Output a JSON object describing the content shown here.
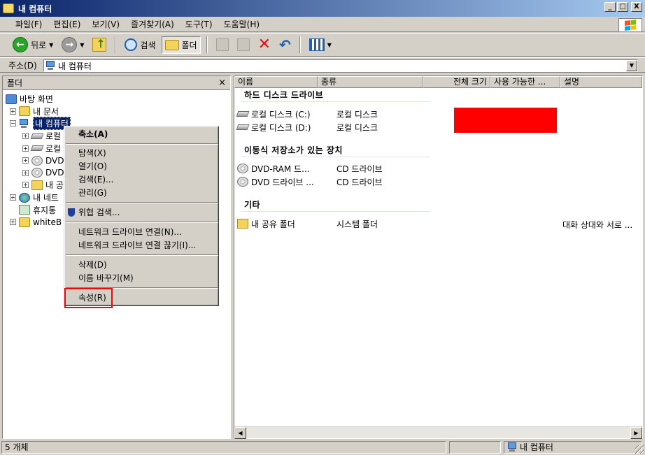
{
  "window": {
    "title": "내 컴퓨터",
    "buttons": {
      "minimize": "_",
      "maximize": "□",
      "close": "X"
    }
  },
  "menubar": {
    "items": [
      "파일(F)",
      "편집(E)",
      "보기(V)",
      "즐겨찾기(A)",
      "도구(T)",
      "도움말(H)"
    ]
  },
  "toolbar": {
    "back_label": "뒤로",
    "search_label": "검색",
    "folders_label": "폴더",
    "icons": {
      "back": "back-arrow-icon",
      "forward": "forward-arrow-icon",
      "up": "folder-up-icon",
      "search": "magnifier-icon",
      "folders": "folders-icon",
      "move_to": "move-to-icon",
      "copy_to": "copy-to-icon",
      "delete": "delete-x-icon",
      "undo": "undo-icon",
      "views": "views-icon"
    }
  },
  "address": {
    "label": "주소(D)",
    "value": "내 컴퓨터"
  },
  "folder_pane": {
    "title": "폴더",
    "close": "×",
    "tree": [
      {
        "label": "바탕 화면",
        "icon": "desktop-icon"
      },
      {
        "label": "내 문서",
        "icon": "folder-icon"
      },
      {
        "label": "내 컴퓨터",
        "icon": "computer-icon",
        "selected": true
      },
      {
        "label": "로컬",
        "icon": "drive-icon"
      },
      {
        "label": "로컬",
        "icon": "drive-icon"
      },
      {
        "label": "DVD",
        "icon": "cd-icon"
      },
      {
        "label": "DVD",
        "icon": "cd-icon"
      },
      {
        "label": "내 공",
        "icon": "shared-folder-icon"
      },
      {
        "label": "내 네트",
        "icon": "network-icon"
      },
      {
        "label": "휴지통",
        "icon": "recycle-bin-icon"
      },
      {
        "label": "whiteB",
        "icon": "folder-icon"
      }
    ]
  },
  "context_menu": {
    "items": [
      {
        "label": "축소(A)",
        "bold": true
      },
      {
        "label": "탐색(X)"
      },
      {
        "label": "열기(O)"
      },
      {
        "label": "검색(E)..."
      },
      {
        "label": "관리(G)"
      },
      {
        "label": "위협 검색...",
        "icon": "shield-icon"
      },
      {
        "label": "네트워크 드라이브 연결(N)..."
      },
      {
        "label": "네트워크 드라이브 연결 끊기(I)..."
      },
      {
        "label": "삭제(D)"
      },
      {
        "label": "이름 바꾸기(M)"
      },
      {
        "label": "속성(R)",
        "highlighted": true
      }
    ]
  },
  "list": {
    "columns": [
      "이름",
      "종류",
      "전체 크기",
      "사용 가능한 ...",
      "설명"
    ],
    "groups": [
      {
        "title": "하드 디스크 드라이브",
        "items": [
          {
            "name": "로컬 디스크 (C:)",
            "type": "로컬 디스크",
            "icon": "drive-icon"
          },
          {
            "name": "로컬 디스크 (D:)",
            "type": "로컬 디스크",
            "icon": "drive-icon"
          }
        ]
      },
      {
        "title": "이동식 저장소가 있는 장치",
        "items": [
          {
            "name": "DVD-RAM 드...",
            "type": "CD 드라이브",
            "icon": "cd-icon"
          },
          {
            "name": "DVD 드라이브 ...",
            "type": "CD 드라이브",
            "icon": "cd-icon"
          }
        ]
      },
      {
        "title": "기타",
        "items": [
          {
            "name": "내 공유 폴더",
            "type": "시스템 폴더",
            "comment": "대화 상대와 서로 ...",
            "icon": "shared-folder-icon"
          }
        ]
      }
    ],
    "redaction_color": "#ff0000"
  },
  "statusbar": {
    "count": "5 개체",
    "location": "내 컴퓨터"
  },
  "colors": {
    "title_start": "#0a246a",
    "title_end": "#a6caf0",
    "face": "#d4d0c8",
    "selection": "#0a246a",
    "highlight_box": "#e01010"
  }
}
